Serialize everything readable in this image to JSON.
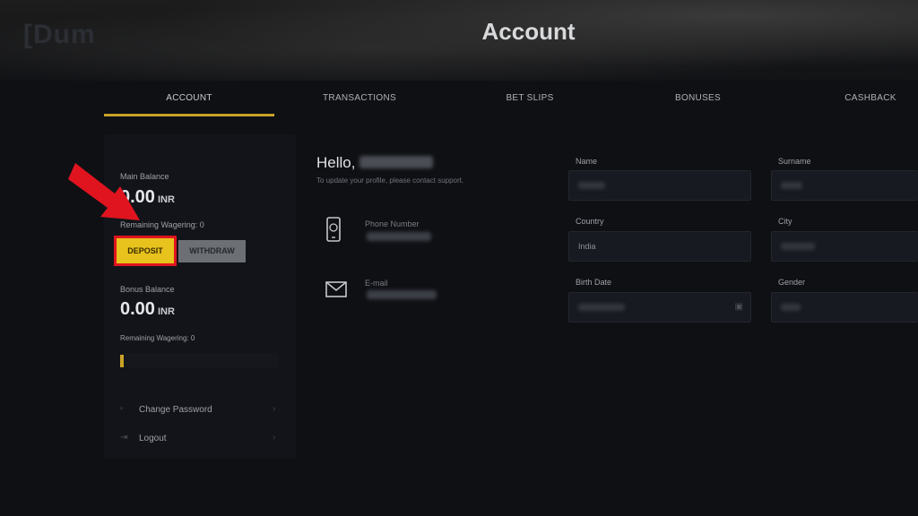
{
  "header": {
    "logo": "[Dum",
    "title": "Account"
  },
  "tabs": [
    {
      "label": "ACCOUNT",
      "active": true
    },
    {
      "label": "TRANSACTIONS",
      "active": false
    },
    {
      "label": "BET SLIPS",
      "active": false
    },
    {
      "label": "BONUSES",
      "active": false
    },
    {
      "label": "CASHBACK",
      "active": false
    }
  ],
  "sidebar": {
    "main_balance_label": "Main Balance",
    "main_balance_value": "0.00",
    "main_currency": "INR",
    "main_wagering": "Remaining Wagering: 0",
    "deposit_label": "DEPOSIT",
    "withdraw_label": "WITHDRAW",
    "bonus_balance_label": "Bonus Balance",
    "bonus_balance_value": "0.00",
    "bonus_currency": "INR",
    "bonus_wagering": "Remaining Wagering: 0",
    "wagering_progress": 0.02,
    "links": [
      {
        "label": "Change Password",
        "icon": "lock-icon"
      },
      {
        "label": "Logout",
        "icon": "logout-icon"
      }
    ]
  },
  "profile": {
    "greeting": "Hello,",
    "support_note": "To update your profile, please contact support.",
    "phone_label": "Phone Number",
    "email_label": "E-mail"
  },
  "form": {
    "name_label": "Name",
    "surname_label": "Surname",
    "country_label": "Country",
    "country_value": "India",
    "city_label": "City",
    "birth_label": "Birth Date",
    "gender_label": "Gender"
  },
  "colors": {
    "accent": "#c9a227",
    "deposit": "#e8c21d",
    "highlight": "#e0141f"
  }
}
